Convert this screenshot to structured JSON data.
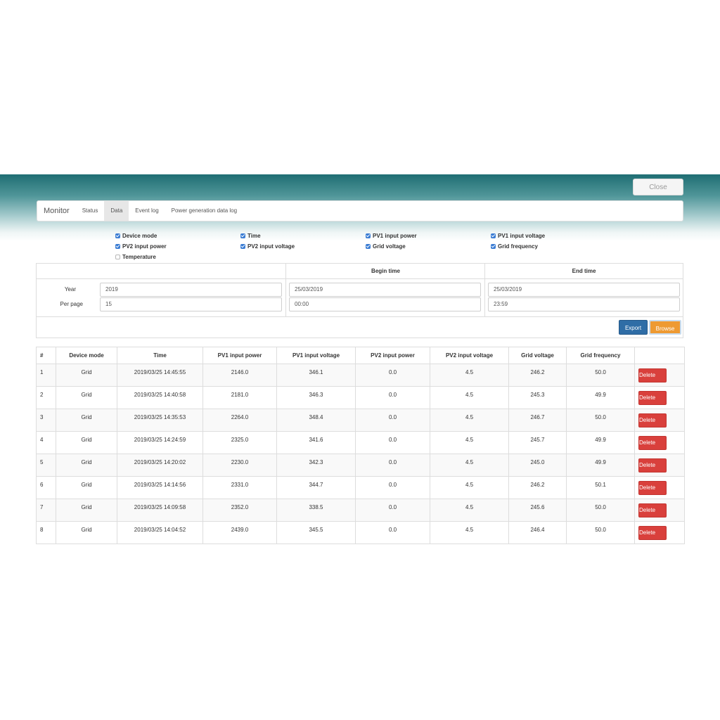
{
  "header": {
    "close_label": "Close"
  },
  "nav": {
    "brand": "Monitor",
    "tabs": [
      {
        "label": "Status"
      },
      {
        "label": "Data"
      },
      {
        "label": "Event log"
      },
      {
        "label": "Power generation data log"
      }
    ]
  },
  "fields": [
    {
      "label": "Device mode",
      "checked": true
    },
    {
      "label": "Time",
      "checked": true
    },
    {
      "label": "PV1 input power",
      "checked": true
    },
    {
      "label": "PV1 input voltage",
      "checked": true
    },
    {
      "label": "PV2 input power",
      "checked": true
    },
    {
      "label": "PV2 input voltage",
      "checked": true
    },
    {
      "label": "Grid voltage",
      "checked": true
    },
    {
      "label": "Grid frequency",
      "checked": true
    },
    {
      "label": "Temperature",
      "checked": false
    }
  ],
  "filter": {
    "begin_header": "Begin time",
    "end_header": "End time",
    "year_label": "Year",
    "year_value": "2019",
    "per_page_label": "Per page",
    "per_page_value": "15",
    "begin_date": "25/03/2019",
    "begin_time": "00:00",
    "end_date": "25/03/2019",
    "end_time": "23:59",
    "export_label": "Export",
    "browse_label": "Browse"
  },
  "table": {
    "columns": [
      "#",
      "Device mode",
      "Time",
      "PV1 input power",
      "PV1 input voltage",
      "PV2 input power",
      "PV2 input voltage",
      "Grid voltage",
      "Grid frequency",
      ""
    ],
    "delete_label": "Delete",
    "rows": [
      [
        "1",
        "Grid",
        "2019/03/25 14:45:55",
        "2146.0",
        "346.1",
        "0.0",
        "4.5",
        "246.2",
        "50.0"
      ],
      [
        "2",
        "Grid",
        "2019/03/25 14:40:58",
        "2181.0",
        "346.3",
        "0.0",
        "4.5",
        "245.3",
        "49.9"
      ],
      [
        "3",
        "Grid",
        "2019/03/25 14:35:53",
        "2264.0",
        "348.4",
        "0.0",
        "4.5",
        "246.7",
        "50.0"
      ],
      [
        "4",
        "Grid",
        "2019/03/25 14:24:59",
        "2325.0",
        "341.6",
        "0.0",
        "4.5",
        "245.7",
        "49.9"
      ],
      [
        "5",
        "Grid",
        "2019/03/25 14:20:02",
        "2230.0",
        "342.3",
        "0.0",
        "4.5",
        "245.0",
        "49.9"
      ],
      [
        "6",
        "Grid",
        "2019/03/25 14:14:56",
        "2331.0",
        "344.7",
        "0.0",
        "4.5",
        "246.2",
        "50.1"
      ],
      [
        "7",
        "Grid",
        "2019/03/25 14:09:58",
        "2352.0",
        "338.5",
        "0.0",
        "4.5",
        "245.6",
        "50.0"
      ],
      [
        "8",
        "Grid",
        "2019/03/25 14:04:52",
        "2439.0",
        "345.5",
        "0.0",
        "4.5",
        "246.4",
        "50.0"
      ]
    ]
  }
}
